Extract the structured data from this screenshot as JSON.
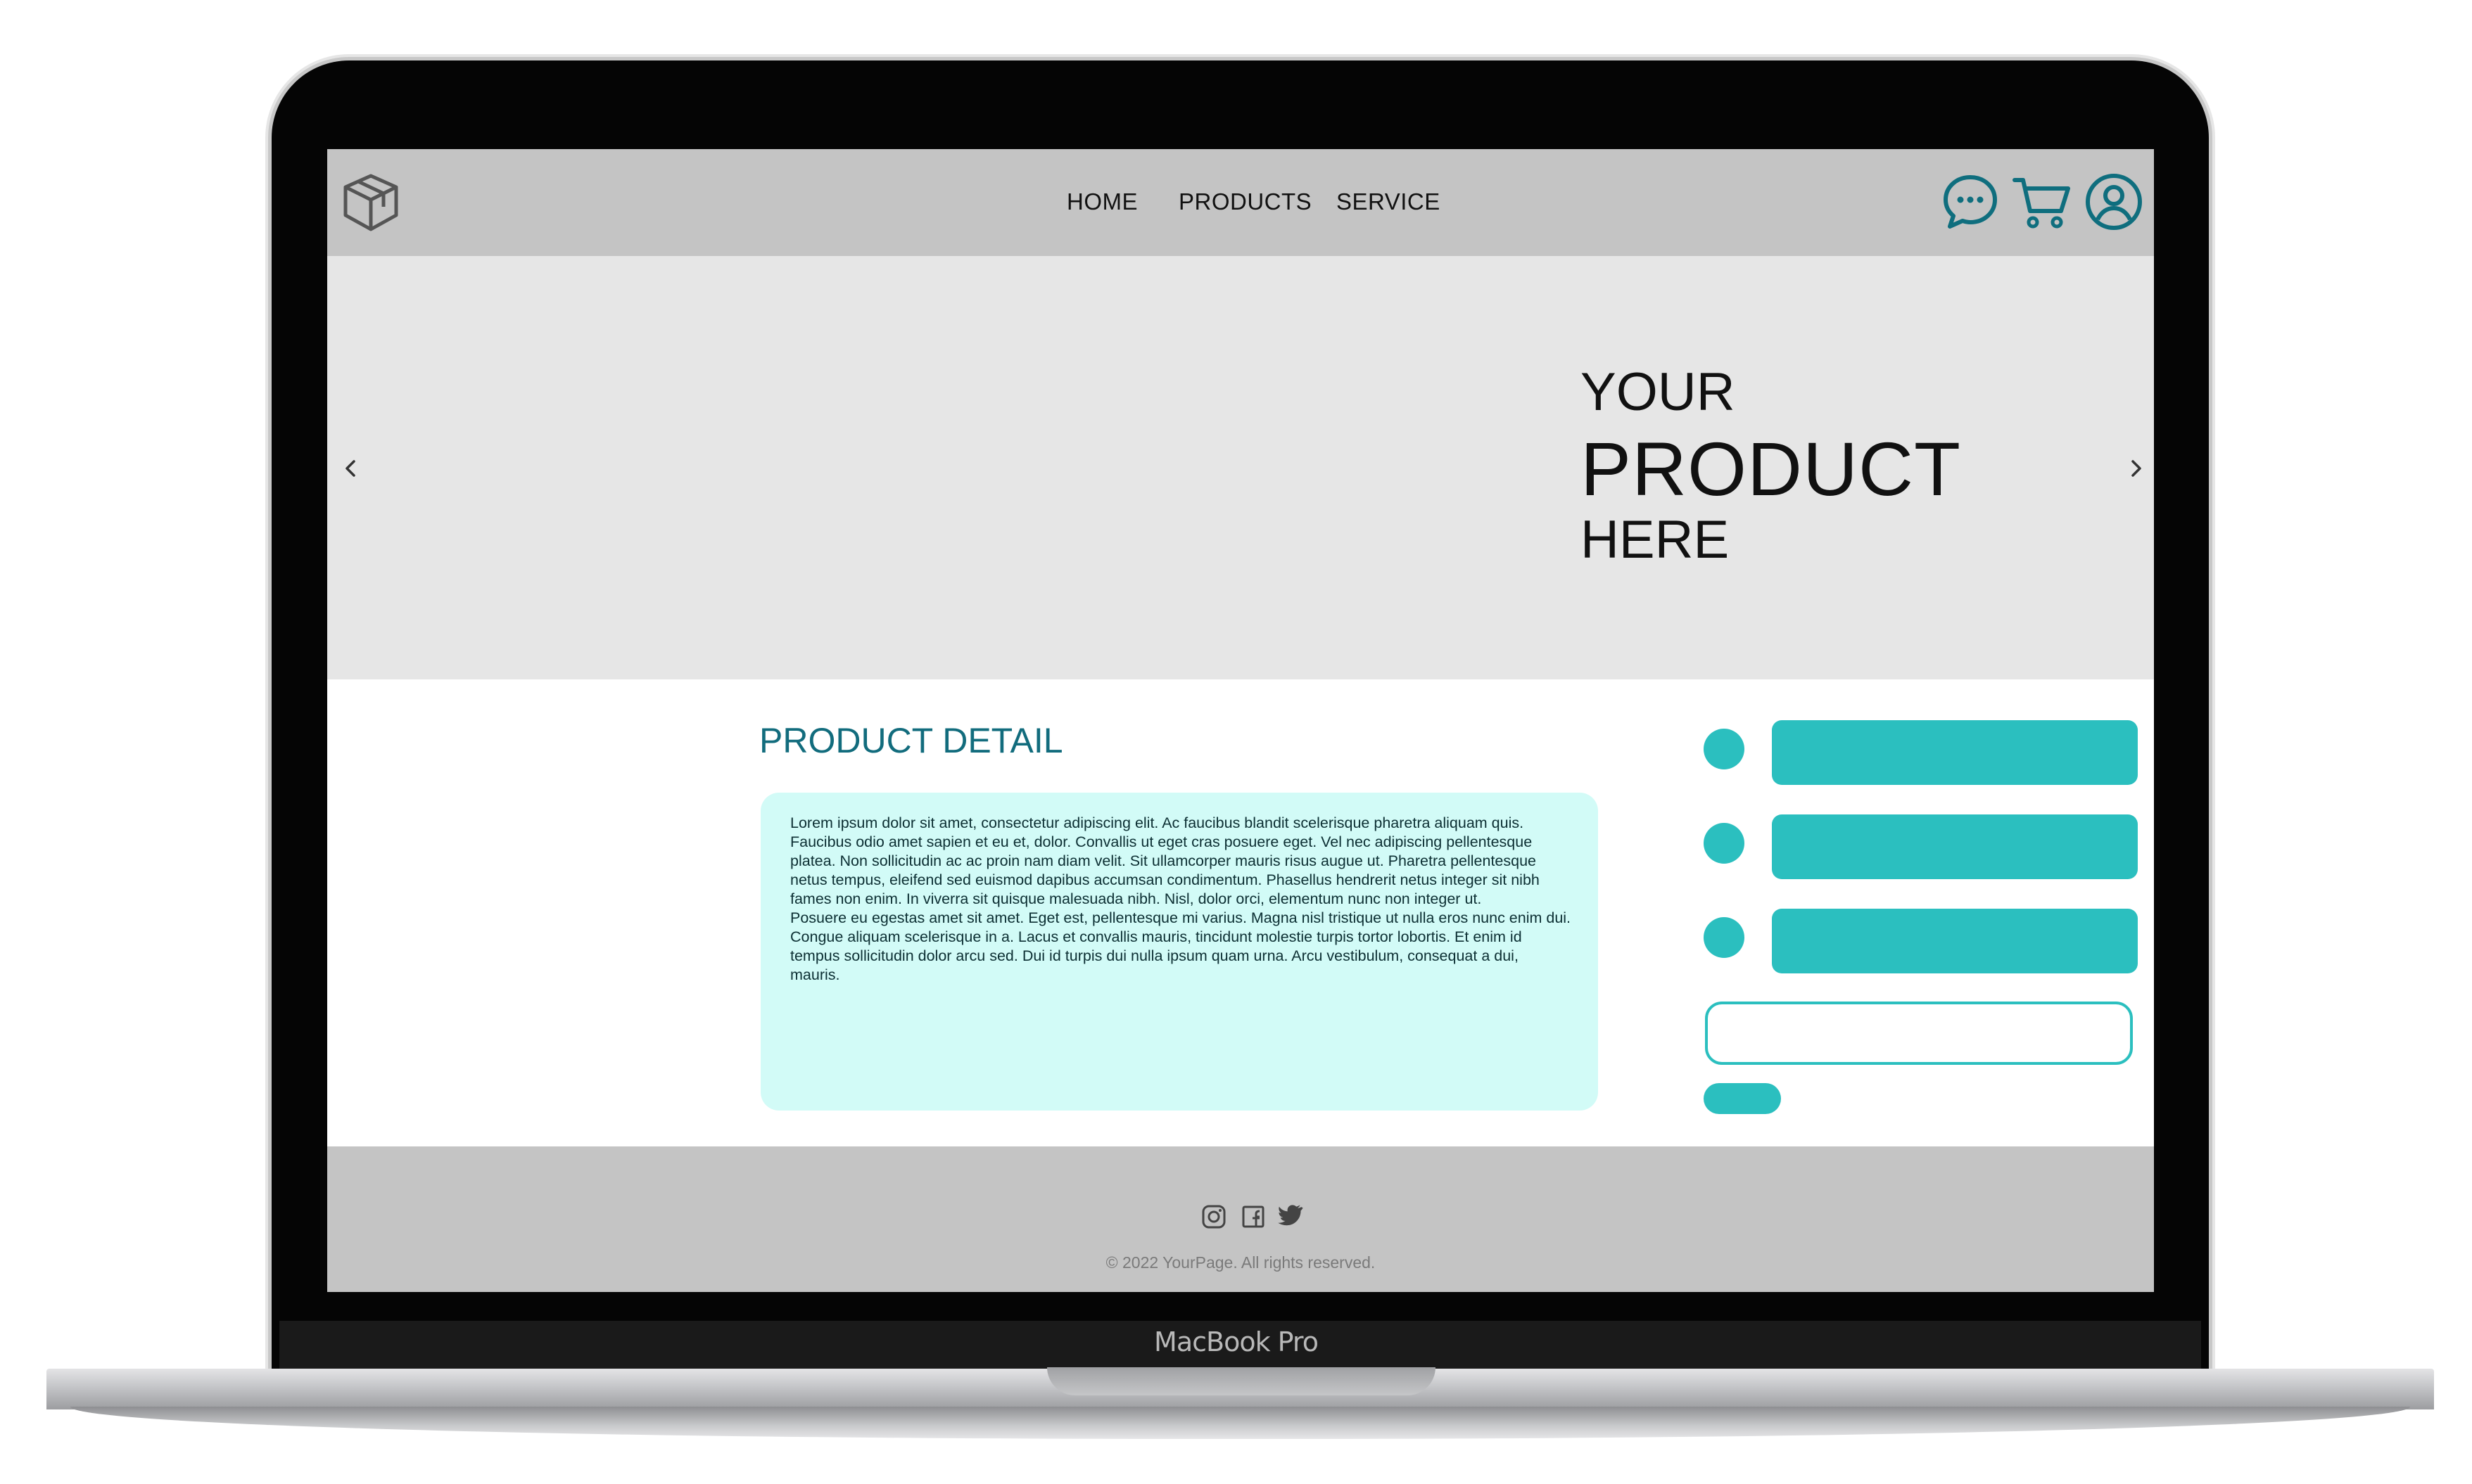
{
  "device": {
    "brand_label": "MacBook Pro"
  },
  "nav": {
    "logo_icon": "cube-icon",
    "items": [
      {
        "label": "HOME"
      },
      {
        "label": "PRODUCTS"
      },
      {
        "label": "SERVICE"
      }
    ],
    "icons": [
      "chat-icon",
      "cart-icon",
      "user-icon"
    ]
  },
  "hero": {
    "line1": "YOUR",
    "line2": "PRODUCT",
    "line3": "HERE",
    "prev_icon": "chevron-left-icon",
    "next_icon": "chevron-right-icon"
  },
  "detail": {
    "title": "PRODUCT DETAIL",
    "paragraph1": "Lorem ipsum dolor sit amet, consectetur adipiscing elit. Ac faucibus blandit scelerisque pharetra aliquam quis. Faucibus odio amet sapien et eu et, dolor. Convallis ut eget cras posuere eget. Vel nec adipiscing pellentesque platea. Non sollicitudin ac ac proin nam diam velit. Sit ullamcorper mauris risus augue ut. Pharetra pellentesque netus tempus, eleifend sed euismod dapibus accumsan condimentum. Phasellus hendrerit netus integer sit nibh fames non enim. In viverra sit quisque malesuada nibh. Nisl, dolor orci, elementum nunc non integer ut.",
    "paragraph2": "Posuere eu egestas amet sit amet. Eget est, pellentesque mi varius. Magna nisl tristique ut nulla eros nunc enim dui. Congue aliquam scelerisque in a. Lacus et convallis mauris, tincidunt molestie turpis tortor lobortis. Et enim id tempus sollicitudin dolor arcu sed. Dui id turpis dui nulla ipsum quam urna. Arcu vestibulum, consequat a dui, mauris."
  },
  "options": {
    "count": 3
  },
  "quantity_input": {
    "value": "",
    "placeholder": ""
  },
  "footer": {
    "social_icons": [
      "instagram-icon",
      "facebook-icon",
      "twitter-icon"
    ],
    "copyright": "© 2022 YourPage. All rights reserved."
  },
  "colors": {
    "accent": "#2bbfbf",
    "title": "#126c7d",
    "detail_bg": "#d2fbf7",
    "nav_bg": "#c4c4c4",
    "hero_bg": "#e6e6e6",
    "icon": "#0f6e7e"
  }
}
